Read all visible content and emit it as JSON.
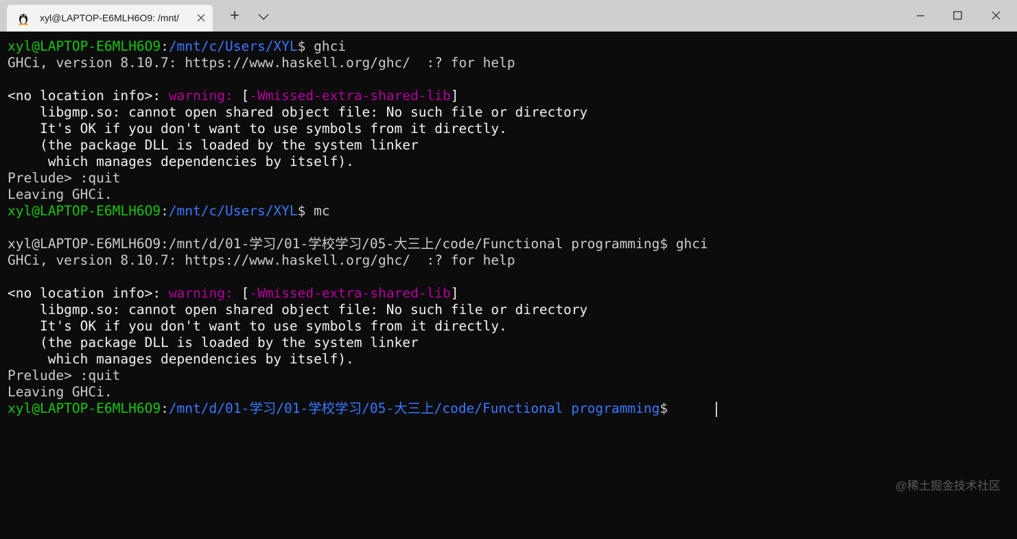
{
  "tab": {
    "title": "xyl@LAPTOP-E6MLH6O9: /mnt/",
    "icon": "linux-penguin-icon",
    "close_icon": "close-icon"
  },
  "toolbar": {
    "new_tab_label": "+",
    "dropdown_icon": "chevron-down-icon"
  },
  "window": {
    "minimize_icon": "minimize-icon",
    "maximize_icon": "maximize-icon",
    "close_icon": "close-icon"
  },
  "terminal": {
    "lines": [
      {
        "user": "xyl@LAPTOP-E6MLH6O9",
        "path": "/mnt/c/Users/XYL",
        "cmd": " ghci"
      },
      {
        "text": "GHCi, version 8.10.7: https://www.haskell.org/ghc/  :? for help"
      },
      {
        "text": ""
      },
      {
        "pre": "<no location info>: ",
        "warn": "warning: ",
        "b1": "[",
        "flag": "-Wmissed-extra-shared-lib",
        "b2": "]"
      },
      {
        "text": "    libgmp.so: cannot open shared object file: No such file or directory"
      },
      {
        "text": "    It's OK if you don't want to use symbols from it directly."
      },
      {
        "text": "    (the package DLL is loaded by the system linker"
      },
      {
        "text": "     which manages dependencies by itself)."
      },
      {
        "text": "Prelude> :quit"
      },
      {
        "text": "Leaving GHCi."
      },
      {
        "user": "xyl@LAPTOP-E6MLH6O9",
        "path": "/mnt/c/Users/XYL",
        "cmd": " mc"
      },
      {
        "text": ""
      },
      {
        "text": "xyl@LAPTOP-E6MLH6O9:/mnt/d/01-学习/01-学校学习/05-大三上/code/Functional programming$ ghci"
      },
      {
        "text": "GHCi, version 8.10.7: https://www.haskell.org/ghc/  :? for help"
      },
      {
        "text": ""
      },
      {
        "pre": "<no location info>: ",
        "warn": "warning: ",
        "b1": "[",
        "flag": "-Wmissed-extra-shared-lib",
        "b2": "]"
      },
      {
        "text": "    libgmp.so: cannot open shared object file: No such file or directory"
      },
      {
        "text": "    It's OK if you don't want to use symbols from it directly."
      },
      {
        "text": "    (the package DLL is loaded by the system linker"
      },
      {
        "text": "     which manages dependencies by itself)."
      },
      {
        "text": "Prelude> :quit"
      },
      {
        "text": "Leaving GHCi."
      },
      {
        "user": "xyl@LAPTOP-E6MLH6O9",
        "path": "/mnt/d/01-学习/01-学校学习/05-大三上/code/Functional programming",
        "cmd": " "
      }
    ]
  },
  "watermark": "@稀土掘金技术社区",
  "colors": {
    "background": "#0c0c0c",
    "foreground": "#cccccc",
    "green": "#16c60c",
    "blue": "#3b78ff",
    "magenta": "#b4009e"
  }
}
